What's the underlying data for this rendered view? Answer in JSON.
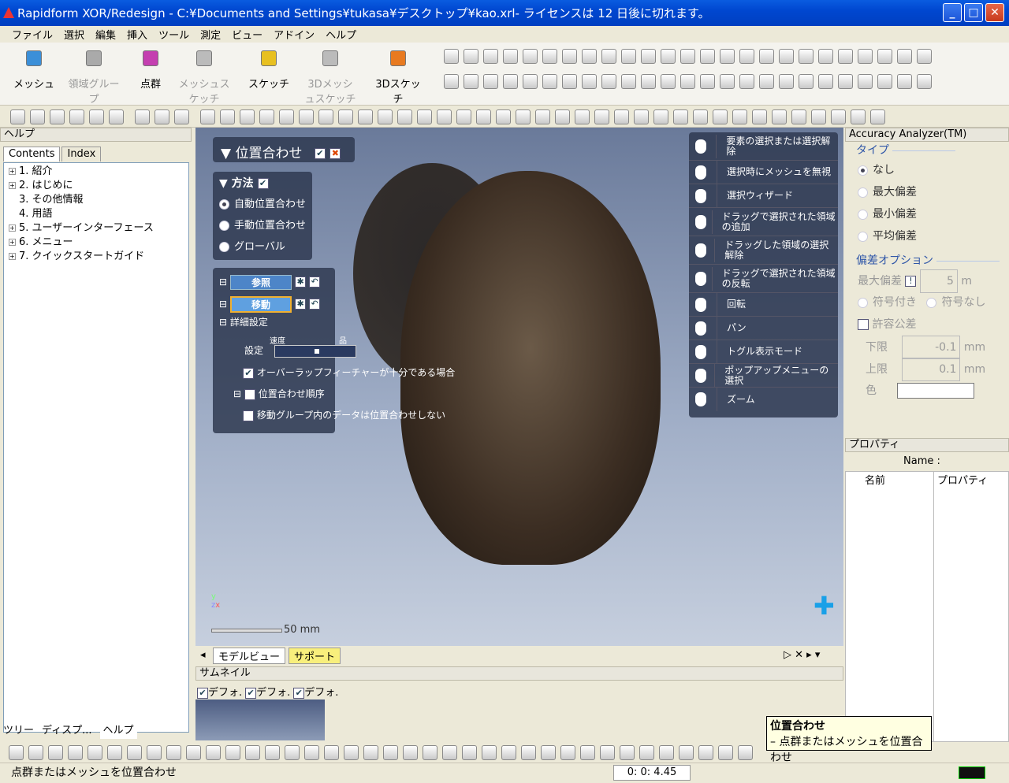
{
  "window": {
    "title": "Rapidform XOR/Redesign - C:¥Documents and Settings¥tukasa¥デスクトップ¥kao.xrl- ライセンスは 12 日後に切れます。"
  },
  "menu": [
    "ファイル",
    "選択",
    "編集",
    "挿入",
    "ツール",
    "測定",
    "ビュー",
    "アドイン",
    "ヘルプ"
  ],
  "ribbon": [
    {
      "label": "メッシュ",
      "enabled": true
    },
    {
      "label": "領域グループ",
      "enabled": false
    },
    {
      "label": "点群",
      "enabled": true
    },
    {
      "label": "メッシュスケッチ",
      "enabled": false
    },
    {
      "label": "スケッチ",
      "enabled": true
    },
    {
      "label": "3Dメッシュスケッチ",
      "enabled": false
    },
    {
      "label": "3Dスケッチ",
      "enabled": true
    }
  ],
  "help_panel": {
    "title": "ヘルプ",
    "tabs": [
      "Contents",
      "Index"
    ],
    "tree": [
      {
        "label": "1. 紹介",
        "expand": true
      },
      {
        "label": "2. はじめに",
        "expand": true
      },
      {
        "label": "3. その他情報",
        "expand": false
      },
      {
        "label": "4. 用語",
        "expand": false
      },
      {
        "label": "5. ユーザーインターフェース",
        "expand": true
      },
      {
        "label": "6. メニュー",
        "expand": true
      },
      {
        "label": "7. クイックスタートガイド",
        "expand": true
      }
    ],
    "bottom_tabs": [
      "ツリー",
      "ディスプ...",
      "ヘルプ"
    ]
  },
  "align_panel": {
    "title": "位置合わせ",
    "method_title": "方法",
    "methods": [
      "自動位置合わせ",
      "手動位置合わせ",
      "グローバル"
    ],
    "reference_label": "参照",
    "moving_label": "移動",
    "details_label": "詳細設定",
    "setting_label": "設定",
    "speed_label": "速度",
    "quality_label": "品質",
    "option1": "オーバーラップフィーチャーが十分である場合",
    "option2": "位置合わせ順序",
    "option3": "移動グループ内のデータは位置合わせしない"
  },
  "mouse_help": [
    "要素の選択または選択解除",
    "選択時にメッシュを無視",
    "選択ウィザード",
    "ドラッグで選択された領域の追加",
    "ドラッグした領域の選択解除",
    "ドラッグで選択された領域の反転",
    "回転",
    "パン",
    "トグル表示モード",
    "ポップアップメニューの選択",
    "ズーム"
  ],
  "viewport": {
    "scale_label": "50 mm",
    "axis_x": "x",
    "axis_y": "y",
    "axis_z": "z"
  },
  "view_tabs": [
    "モデルビュー",
    "サポート"
  ],
  "accuracy": {
    "title": "Accuracy Analyzer(TM)",
    "type_label": "タイプ",
    "types": [
      "なし",
      "最大偏差",
      "最小偏差",
      "平均偏差"
    ],
    "deviation_options": "偏差オプション",
    "max_dev_label": "最大偏差",
    "max_dev_value": "5",
    "unit": "m",
    "signed": "符号付き",
    "unsigned": "符号なし",
    "tolerance": "許容公差",
    "lower": "下限",
    "lower_value": "-0.1",
    "upper": "上限",
    "upper_value": "0.1",
    "mm": "mm",
    "color": "色"
  },
  "properties": {
    "title": "プロパティ",
    "name_label": "Name :",
    "col1": "名前",
    "col2": "プロパティ"
  },
  "thumbnails": {
    "title": "サムネイル",
    "items": [
      "デフォ.",
      "デフォ.",
      "デフォ."
    ]
  },
  "tooltip": {
    "title": "位置合わせ",
    "text": "点群またはメッシュを位置合わせ"
  },
  "status": {
    "text": "点群またはメッシュを位置合わせ",
    "time": "0: 0: 4.45"
  }
}
